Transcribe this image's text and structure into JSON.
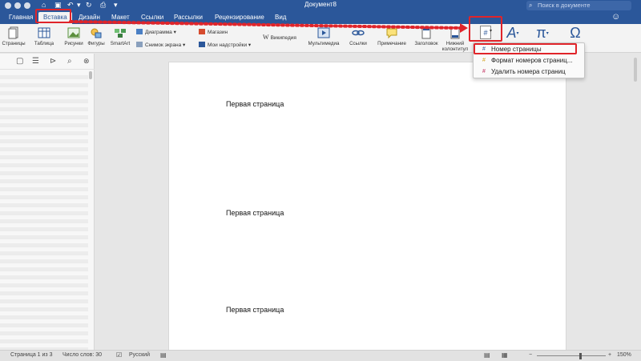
{
  "window": {
    "title": "Документ8",
    "search_placeholder": "Поиск в документе"
  },
  "tabs": [
    {
      "label": "Главная"
    },
    {
      "label": "Вставка"
    },
    {
      "label": "Дизайн"
    },
    {
      "label": "Макет"
    },
    {
      "label": "Ссылки"
    },
    {
      "label": "Рассылки"
    },
    {
      "label": "Рецензирование"
    },
    {
      "label": "Вид"
    }
  ],
  "ribbon": {
    "pages": "Страницы",
    "table": "Таблица",
    "pictures": "Рисунки",
    "shapes": "Фигуры",
    "smartart": "SmartArt",
    "diagram": "Диаграмма",
    "screenshot": "Снимок экрана",
    "store": "Магазин",
    "my_addins": "Мои надстройки",
    "wikipedia": "Википедия",
    "media": "Мультимедиа",
    "links": "Ссылки",
    "comment": "Примечание",
    "header": "Заголовок",
    "footer_line1": "Нижний",
    "footer_line2": "колонтитул",
    "page_number_symbol": "#",
    "textbox_symbol": "A",
    "equation_symbol": "π",
    "symbol_symbol": "Ω"
  },
  "dropdown": {
    "items": [
      {
        "label": "Номер страницы",
        "icon": "#"
      },
      {
        "label": "Формат номеров страниц...",
        "icon": "#"
      },
      {
        "label": "Удалить номера страниц",
        "icon": "#"
      }
    ]
  },
  "document": {
    "lines": [
      "Первая страница",
      "Первая страница",
      "Первая страница"
    ]
  },
  "status": {
    "page": "Страница 1 из 3",
    "words": "Число слов: 30",
    "language": "Русский",
    "zoom": "150%"
  },
  "colors": {
    "accent": "#2b579a",
    "annotation": "#e0242a"
  }
}
